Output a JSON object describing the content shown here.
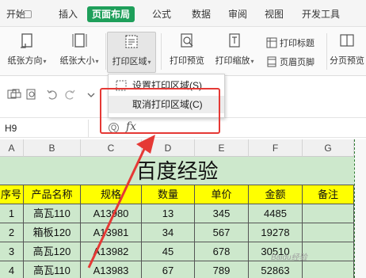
{
  "tabs": [
    "开始",
    "插入",
    "页面布局",
    "公式",
    "数据",
    "审阅",
    "视图",
    "开发工具"
  ],
  "ribbon": {
    "paper_direction": "纸张方向",
    "paper_size": "纸张大小",
    "print_area": "打印区域",
    "print_preview": "打印预览",
    "print_scale": "打印缩放",
    "print_titles": "打印标题",
    "header_footer": "页眉页脚",
    "page_preview": "分页预览"
  },
  "dropdown": {
    "set_print_area": "设置打印区域(S)",
    "cancel_print_area": "取消打印区域(C)"
  },
  "formula_bar": {
    "name_box": "H9",
    "fx": "fx",
    "zoom": "Q"
  },
  "columns": [
    "A",
    "B",
    "C",
    "D",
    "E",
    "F",
    "G"
  ],
  "sheet": {
    "title": "百度经验",
    "headers": [
      "序号",
      "产品名称",
      "规格",
      "数量",
      "单价",
      "金额",
      "备注"
    ],
    "rows": [
      [
        "1",
        "高瓦110",
        "A13980",
        "13",
        "345",
        "4485",
        ""
      ],
      [
        "2",
        "箱板120",
        "A13981",
        "34",
        "567",
        "19278",
        ""
      ],
      [
        "3",
        "高瓦120",
        "A13982",
        "45",
        "678",
        "30510",
        ""
      ],
      [
        "4",
        "高瓦110",
        "A13983",
        "67",
        "789",
        "52863",
        ""
      ]
    ]
  },
  "watermark": "Baidu经验",
  "colors": {
    "accent": "#1e9f5a",
    "header_fill": "#ffff00",
    "body_fill": "#cde8cc",
    "highlight": "#e53935"
  }
}
